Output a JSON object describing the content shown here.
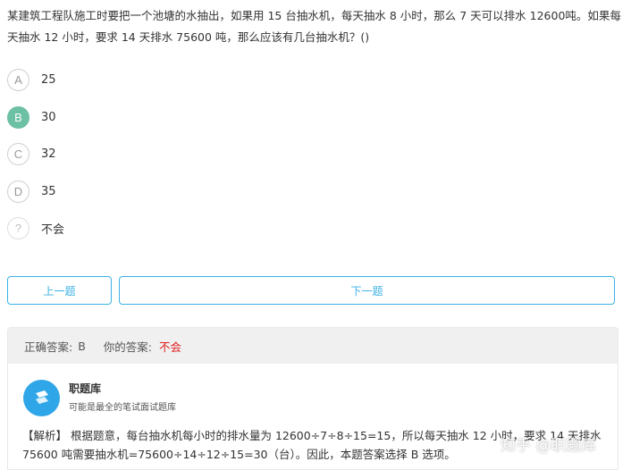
{
  "question": {
    "text": "某建筑工程队施工时要把一个池塘的水抽出，如果用 15 台抽水机，每天抽水 8 小时，那么 7 天可以排水 12600吨。如果每天抽水 12 小时，要求 14 天排水 75600 吨，那么应该有几台抽水机？()"
  },
  "options": [
    {
      "key": "A",
      "text": "25"
    },
    {
      "key": "B",
      "text": "30"
    },
    {
      "key": "C",
      "text": "32"
    },
    {
      "key": "D",
      "text": "35"
    },
    {
      "key": "?",
      "text": "不会"
    }
  ],
  "selected_option": "B",
  "navigation": {
    "prev_label": "上一题",
    "next_label": "下一题"
  },
  "answer": {
    "correct_label": "正确答案:",
    "correct_value": "B",
    "yours_label": "你的答案:",
    "yours_value": "不会"
  },
  "source": {
    "name": "职题库",
    "tagline": "可能是最全的笔试面试题库"
  },
  "analysis": {
    "text": "【解析】 根据题意，每台抽水机每小时的排水量为 12600÷7÷8÷15=15，所以每天抽水 12 小时，要求 14 天排水 75600 吨需要抽水机=75600÷14÷12÷15=30（台）。因此，本题答案选择 B 选项。"
  },
  "watermark": "知乎 @职题库",
  "colors": {
    "selected_green": "#6cc0a3",
    "button_blue": "#3db2e6",
    "wrong_red": "#e02020",
    "logo_blue": "#2fa6e8"
  }
}
